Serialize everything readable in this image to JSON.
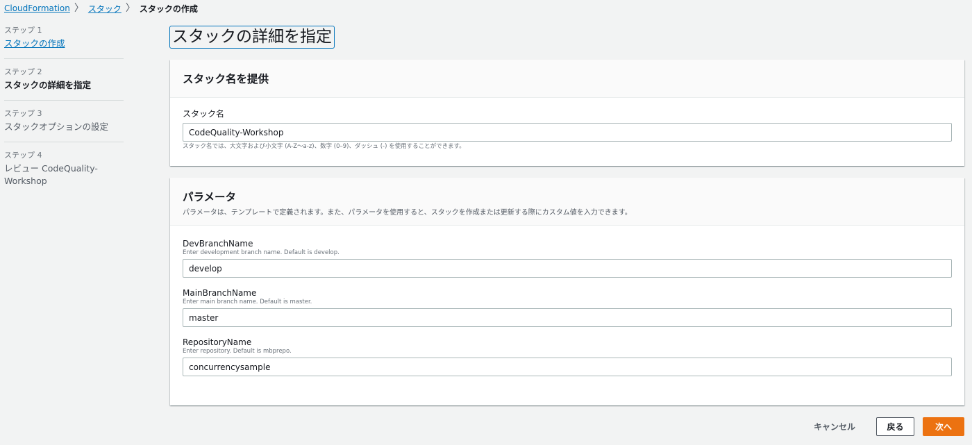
{
  "breadcrumb": {
    "items": [
      "CloudFormation",
      "スタック",
      "スタックの作成"
    ],
    "separator": "〉"
  },
  "steps": [
    {
      "number": "ステップ 1",
      "title": "スタックの作成"
    },
    {
      "number": "ステップ 2",
      "title": "スタックの詳細を指定"
    },
    {
      "number": "ステップ 3",
      "title": "スタックオプションの設定"
    },
    {
      "number": "ステップ 4",
      "title": "レビュー CodeQuality-Workshop"
    }
  ],
  "page_title": "スタックの詳細を指定",
  "stack_name_panel": {
    "title": "スタック名を提供",
    "field_label": "スタック名",
    "value": "CodeQuality-Workshop",
    "constraint": "スタック名では、大文字および小文字 (A-Z〜a-z)、数字 (0–9)、ダッシュ (-) を使用することができます。"
  },
  "parameters_panel": {
    "title": "パラメータ",
    "description": "パラメータは、テンプレートで定義されます。また、パラメータを使用すると、スタックを作成または更新する際にカスタム値を入力できます。",
    "params": [
      {
        "name": "DevBranchName",
        "hint": "Enter development branch name. Default is develop.",
        "value": "develop"
      },
      {
        "name": "MainBranchName",
        "hint": "Enter main branch name. Default is master.",
        "value": "master"
      },
      {
        "name": "RepositoryName",
        "hint": "Enter repository. Default is mbprepo.",
        "value": "concurrencysample"
      }
    ]
  },
  "footer": {
    "cancel_label": "キャンセル",
    "back_label": "戻る",
    "next_label": "次へ"
  },
  "colors": {
    "link": "#0073bb",
    "primary_button": "#ec7211",
    "background": "#f2f3f3"
  }
}
